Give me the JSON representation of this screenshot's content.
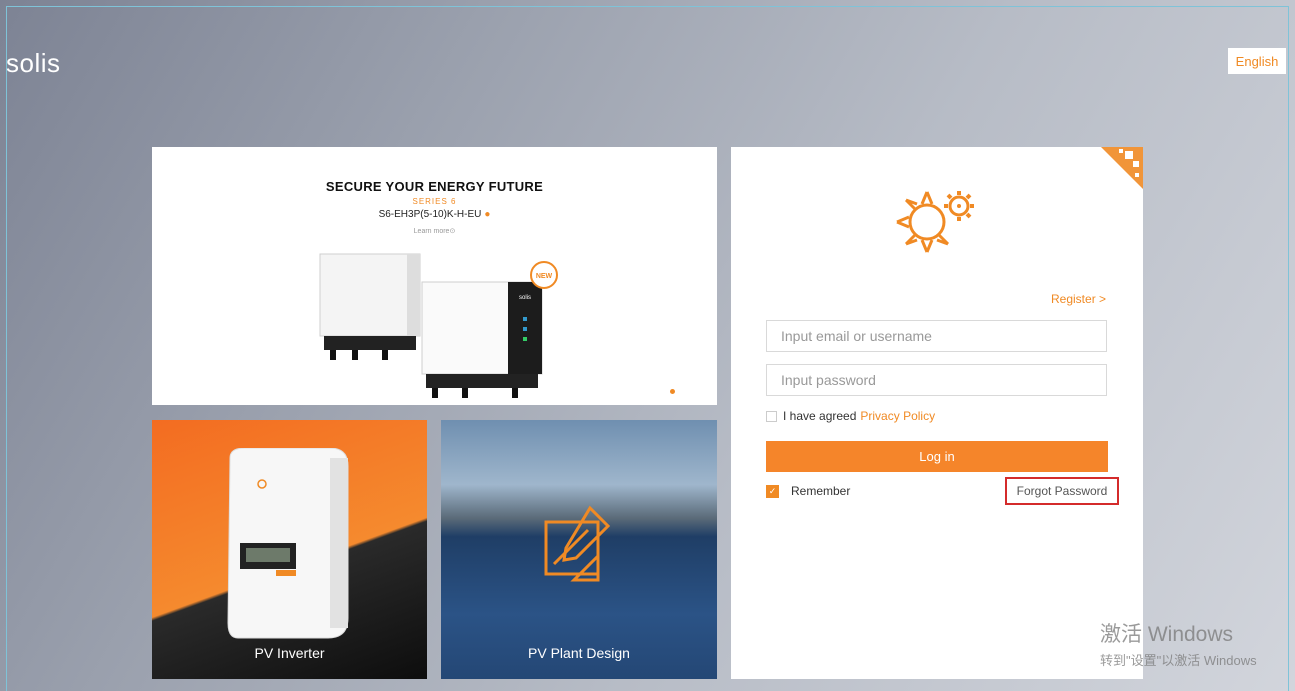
{
  "header": {
    "logo": "solis",
    "language": "English"
  },
  "banner": {
    "title": "SECURE YOUR ENERGY FUTURE",
    "series": "SERIES 6",
    "model": "S6-EH3P(5-10)K-H-EU",
    "learn_more": "Learn more⊙",
    "badge": "NEW",
    "product_logo": "solis"
  },
  "tiles": [
    {
      "label": "PV Inverter"
    },
    {
      "label": "PV Plant Design"
    }
  ],
  "login": {
    "register": "Register >",
    "email_placeholder": "Input email or username",
    "password_placeholder": "Input password",
    "agree_text": "I have agreed",
    "privacy_link": "Privacy Policy",
    "login_button": "Log in",
    "remember": "Remember",
    "remember_checked": true,
    "forgot_password": "Forgot Password"
  },
  "watermark": {
    "line1": "激活 Windows",
    "line2": "转到\"设置\"以激活 Windows"
  },
  "colors": {
    "accent": "#f08a24",
    "highlight": "#d42b2b"
  }
}
